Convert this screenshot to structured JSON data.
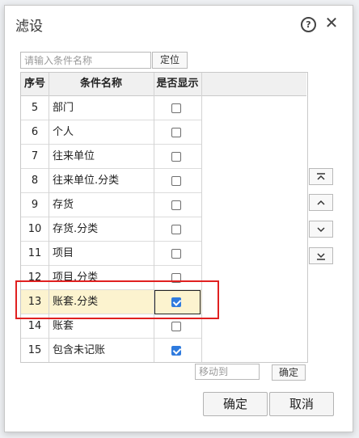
{
  "dialog": {
    "title": "滤设",
    "help_icon": "question-circle-icon",
    "close_icon": "close-icon"
  },
  "search": {
    "placeholder": "请输入条件名称",
    "value": "",
    "locate_label": "定位"
  },
  "table": {
    "columns": [
      "序号",
      "条件名称",
      "是否显示"
    ],
    "rows": [
      {
        "no": "5",
        "name": "部门",
        "show": false
      },
      {
        "no": "6",
        "name": "个人",
        "show": false
      },
      {
        "no": "7",
        "name": "往来单位",
        "show": false
      },
      {
        "no": "8",
        "name": "往来单位.分类",
        "show": false
      },
      {
        "no": "9",
        "name": "存货",
        "show": false
      },
      {
        "no": "10",
        "name": "存货.分类",
        "show": false
      },
      {
        "no": "11",
        "name": "项目",
        "show": false
      },
      {
        "no": "12",
        "name": "项目.分类",
        "show": false
      },
      {
        "no": "13",
        "name": "账套.分类",
        "show": true,
        "selected": true
      },
      {
        "no": "14",
        "name": "账套",
        "show": false
      },
      {
        "no": "15",
        "name": "包含未记账",
        "show": true
      }
    ]
  },
  "move_buttons": [
    "move-to-top-icon",
    "move-up-icon",
    "move-down-icon",
    "move-to-bottom-icon"
  ],
  "move_to": {
    "placeholder": "移动到",
    "confirm_label": "确定"
  },
  "footer": {
    "ok_label": "确定",
    "cancel_label": "取消"
  },
  "colors": {
    "selected_row": "#fcf3cf",
    "checkbox_checked": "#2f7bde",
    "highlight_box": "#e02020"
  }
}
